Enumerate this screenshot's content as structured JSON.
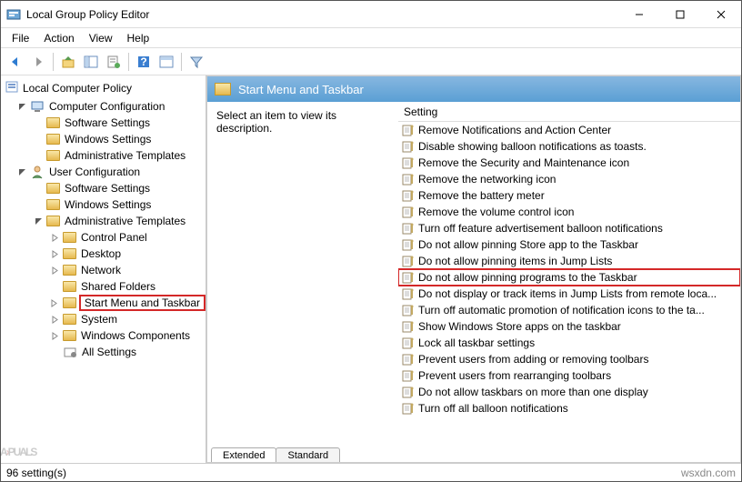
{
  "title": "Local Group Policy Editor",
  "menus": [
    "File",
    "Action",
    "View",
    "Help"
  ],
  "tree_root": "Local Computer Policy",
  "tree": [
    {
      "indent": 0,
      "exp": "open",
      "icon": "computer",
      "label": "Computer Configuration"
    },
    {
      "indent": 1,
      "exp": "leaf",
      "icon": "folder",
      "label": "Software Settings"
    },
    {
      "indent": 1,
      "exp": "leaf",
      "icon": "folder",
      "label": "Windows Settings"
    },
    {
      "indent": 1,
      "exp": "leaf",
      "icon": "folder",
      "label": "Administrative Templates"
    },
    {
      "indent": 0,
      "exp": "open",
      "icon": "user",
      "label": "User Configuration"
    },
    {
      "indent": 1,
      "exp": "leaf",
      "icon": "folder",
      "label": "Software Settings"
    },
    {
      "indent": 1,
      "exp": "leaf",
      "icon": "folder",
      "label": "Windows Settings"
    },
    {
      "indent": 1,
      "exp": "open",
      "icon": "folder-open",
      "label": "Administrative Templates"
    },
    {
      "indent": 2,
      "exp": "closed",
      "icon": "folder",
      "label": "Control Panel"
    },
    {
      "indent": 2,
      "exp": "closed",
      "icon": "folder",
      "label": "Desktop"
    },
    {
      "indent": 2,
      "exp": "closed",
      "icon": "folder",
      "label": "Network"
    },
    {
      "indent": 2,
      "exp": "leaf",
      "icon": "folder",
      "label": "Shared Folders"
    },
    {
      "indent": 2,
      "exp": "closed",
      "icon": "folder",
      "label": "Start Menu and Taskbar",
      "highlighted": true
    },
    {
      "indent": 2,
      "exp": "closed",
      "icon": "folder",
      "label": "System"
    },
    {
      "indent": 2,
      "exp": "closed",
      "icon": "folder",
      "label": "Windows Components"
    },
    {
      "indent": 2,
      "exp": "leaf",
      "icon": "settings",
      "label": "All Settings"
    }
  ],
  "detail_header": "Start Menu and Taskbar",
  "detail_desc": "Select an item to view its description.",
  "list_header": "Setting",
  "settings": [
    {
      "label": "Remove Notifications and Action Center"
    },
    {
      "label": "Disable showing balloon notifications as toasts."
    },
    {
      "label": "Remove the Security and Maintenance icon"
    },
    {
      "label": "Remove the networking icon"
    },
    {
      "label": "Remove the battery meter"
    },
    {
      "label": "Remove the volume control icon"
    },
    {
      "label": "Turn off feature advertisement balloon notifications"
    },
    {
      "label": "Do not allow pinning Store app to the Taskbar"
    },
    {
      "label": "Do not allow pinning items in Jump Lists"
    },
    {
      "label": "Do not allow pinning programs to the Taskbar",
      "highlighted": true
    },
    {
      "label": "Do not display or track items in Jump Lists from remote loca..."
    },
    {
      "label": "Turn off automatic promotion of notification icons to the ta..."
    },
    {
      "label": "Show Windows Store apps on the taskbar"
    },
    {
      "label": "Lock all taskbar settings"
    },
    {
      "label": "Prevent users from adding or removing toolbars"
    },
    {
      "label": "Prevent users from rearranging toolbars"
    },
    {
      "label": "Do not allow taskbars on more than one display"
    },
    {
      "label": "Turn off all balloon notifications"
    }
  ],
  "tabs": {
    "extended": "Extended",
    "standard": "Standard"
  },
  "status": "96 setting(s)",
  "source": "wsxdn.com",
  "watermark": {
    "pre": "A",
    "accent": "›",
    "post": "PUALS"
  }
}
